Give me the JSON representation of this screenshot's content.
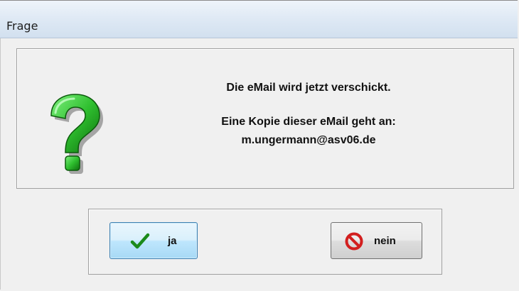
{
  "window": {
    "title": "Frage"
  },
  "message": {
    "line1": "Die eMail wird jetzt verschickt.",
    "line2": "Eine Kopie dieser eMail geht an:",
    "line3": "m.ungermann@asv06.de"
  },
  "buttons": {
    "yes_label": "ja",
    "no_label": "nein"
  },
  "icons": {
    "question": "question-mark-icon",
    "yes": "checkmark-icon",
    "no": "no-entry-icon"
  },
  "colors": {
    "question_green": "#2fbf2f",
    "check_green": "#1a8a1a",
    "no_red": "#d21f1f",
    "titlebar": "#dde8f4"
  }
}
